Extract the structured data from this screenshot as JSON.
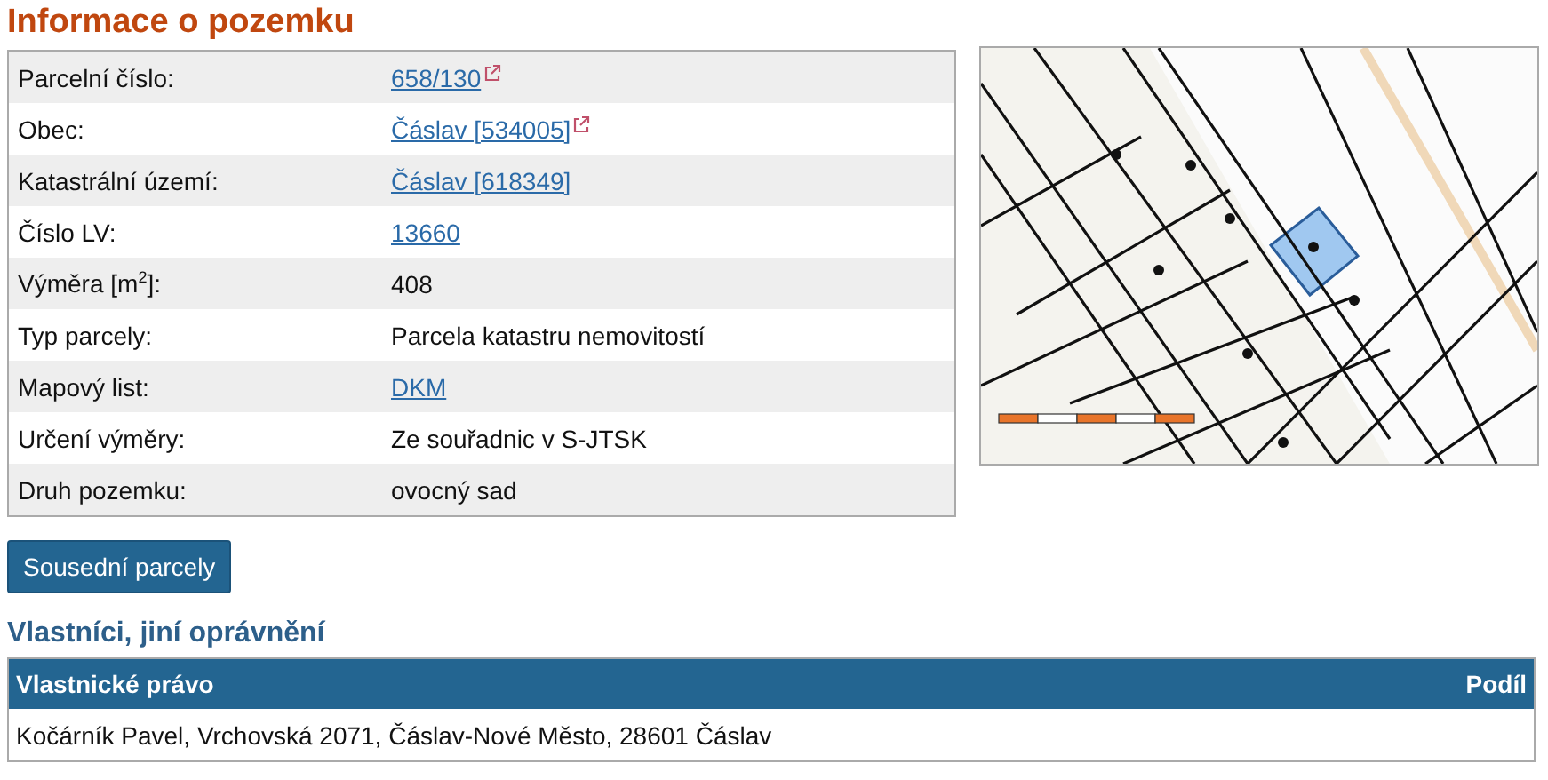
{
  "title": "Informace o pozemku",
  "info_rows": [
    {
      "label": "Parcelní číslo:",
      "value": "658/130",
      "kind": "link",
      "external": true
    },
    {
      "label": "Obec:",
      "value": "Čáslav [534005]",
      "kind": "link",
      "external": true
    },
    {
      "label": "Katastrální území:",
      "value": "Čáslav [618349]",
      "kind": "link",
      "external": false
    },
    {
      "label": "Číslo LV:",
      "value": "13660",
      "kind": "link",
      "external": false
    },
    {
      "label": "Výměra [m$^{2}$]:",
      "value": "408",
      "kind": "text",
      "external": false
    },
    {
      "label": "Typ parcely:",
      "value": "Parcela katastru nemovitostí",
      "kind": "text",
      "external": false
    },
    {
      "label": "Mapový list:",
      "value": "DKM",
      "kind": "link",
      "external": false
    },
    {
      "label": "Určení výměry:",
      "value": "Ze souřadnic v S-JTSK",
      "kind": "text",
      "external": false
    },
    {
      "label": "Druh pozemku:",
      "value": "ovocný sad",
      "kind": "text",
      "external": false
    }
  ],
  "neighbors_button": "Sousední parcely",
  "owners": {
    "heading": "Vlastníci, jiní oprávnění",
    "columns": [
      "Vlastnické právo",
      "Podíl"
    ],
    "rows": [
      [
        "Kočárník Pavel, Vrchovská 2071, Čáslav-Nové Město, 28601 Čáslav",
        ""
      ]
    ]
  }
}
